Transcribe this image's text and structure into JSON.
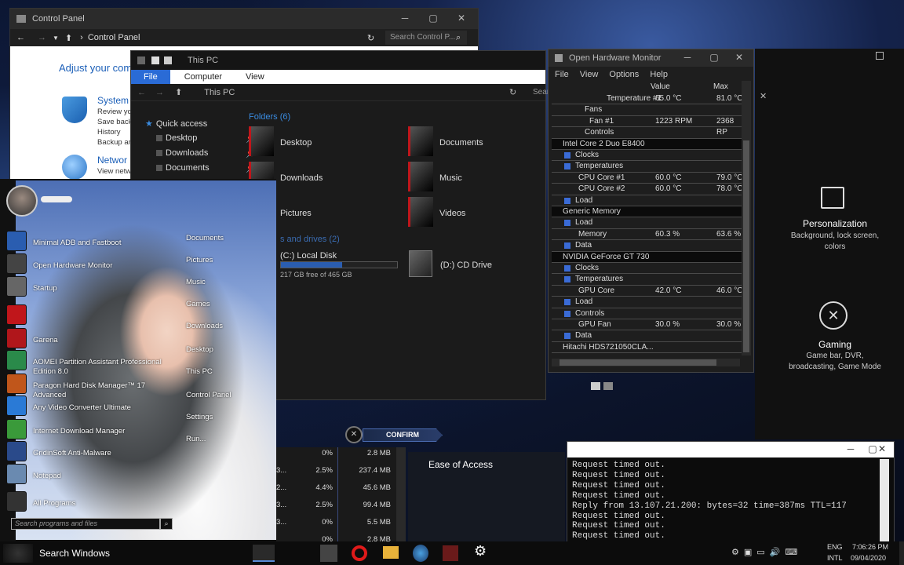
{
  "control_panel": {
    "title": "Control Panel",
    "breadcrumb": "Control Panel",
    "search_placeholder": "Search Control P...",
    "adjust": "Adjust your com",
    "system": "System",
    "system_sub": [
      "Review yo",
      "Save back",
      "History",
      "Backup ar"
    ],
    "network": "Networ",
    "network_sub": "View netw"
  },
  "explorer": {
    "title": "This PC",
    "tabs": [
      "File",
      "Computer",
      "View"
    ],
    "address": "This PC",
    "search": "Sear",
    "folders_header": "Folders (6)",
    "folders": [
      "Desktop",
      "Documents",
      "Downloads",
      "Music",
      "Pictures",
      "Videos"
    ],
    "drives_header": "s and drives (2)",
    "drive_c": "(C:) Local Disk",
    "drive_c_free": "217 GB free of 465 GB",
    "drive_c_fill": 0.53,
    "drive_d": "(D:) CD Drive",
    "quick_access": "Quick access",
    "nav": [
      "Desktop",
      "Downloads",
      "Documents"
    ]
  },
  "ohm": {
    "title": "Open Hardware Monitor",
    "menu": [
      "File",
      "View",
      "Options",
      "Help"
    ],
    "col_value": "Value",
    "col_max": "Max",
    "rows": [
      {
        "name": "Temperature #1",
        "value": "65.0 °C",
        "max": "81.0 °C",
        "indent": 70,
        "hw": false
      },
      {
        "name": "Fans",
        "value": "",
        "max": "",
        "indent": 42,
        "hw": false
      },
      {
        "name": "Fan #1",
        "value": "1223 RPM",
        "max": "2368 RP",
        "indent": 48,
        "hw": false
      },
      {
        "name": "Controls",
        "value": "",
        "max": "",
        "indent": 42,
        "hw": false
      },
      {
        "name": "Intel Core 2 Duo E8400",
        "value": "",
        "max": "",
        "indent": 14,
        "hw": true
      },
      {
        "name": "Clocks",
        "value": "",
        "max": "",
        "indent": 30,
        "hw": false
      },
      {
        "name": "Temperatures",
        "value": "",
        "max": "",
        "indent": 30,
        "hw": false
      },
      {
        "name": "CPU Core #1",
        "value": "60.0 °C",
        "max": "79.0 °C",
        "indent": 34,
        "hw": false
      },
      {
        "name": "CPU Core #2",
        "value": "60.0 °C",
        "max": "78.0 °C",
        "indent": 34,
        "hw": false
      },
      {
        "name": "Load",
        "value": "",
        "max": "",
        "indent": 30,
        "hw": false
      },
      {
        "name": "Generic Memory",
        "value": "",
        "max": "",
        "indent": 14,
        "hw": true
      },
      {
        "name": "Load",
        "value": "",
        "max": "",
        "indent": 30,
        "hw": false
      },
      {
        "name": "Memory",
        "value": "60.3 %",
        "max": "63.6 %",
        "indent": 34,
        "hw": false
      },
      {
        "name": "Data",
        "value": "",
        "max": "",
        "indent": 30,
        "hw": false
      },
      {
        "name": "NVIDIA GeForce GT 730",
        "value": "",
        "max": "",
        "indent": 14,
        "hw": true
      },
      {
        "name": "Clocks",
        "value": "",
        "max": "",
        "indent": 30,
        "hw": false
      },
      {
        "name": "Temperatures",
        "value": "",
        "max": "",
        "indent": 30,
        "hw": false
      },
      {
        "name": "GPU Core",
        "value": "42.0 °C",
        "max": "46.0 °C",
        "indent": 34,
        "hw": false
      },
      {
        "name": "Load",
        "value": "",
        "max": "",
        "indent": 30,
        "hw": false
      },
      {
        "name": "Controls",
        "value": "",
        "max": "",
        "indent": 30,
        "hw": false
      },
      {
        "name": "GPU Fan",
        "value": "30.0 %",
        "max": "30.0 %",
        "indent": 34,
        "hw": false
      },
      {
        "name": "Data",
        "value": "",
        "max": "",
        "indent": 30,
        "hw": false
      },
      {
        "name": "Hitachi HDS721050CLA...",
        "value": "",
        "max": "",
        "indent": 14,
        "hw": false
      }
    ]
  },
  "start_menu": {
    "search_placeholder": "Search programs and files",
    "programs": [
      "Minimal ADB and Fastboot",
      "Open Hardware Monitor",
      "Startup",
      "",
      "Garena",
      "AOMEI Partition Assistant Professional Edition 8.0",
      "Paragon Hard Disk Manager™ 17 Advanced",
      "Any Video Converter Ultimate",
      "Internet Download Manager",
      "GridinSoft Anti-Malware",
      "Notepad",
      "All Programs"
    ],
    "links": [
      "Documents",
      "Pictures",
      "Music",
      "Games",
      "Downloads",
      "Desktop",
      "This PC",
      "Control Panel",
      "Settings",
      "Run..."
    ]
  },
  "confirm_label": "CONFIRM",
  "settings": {
    "personalization": "Personalization",
    "personalization_sub": "Background, lock screen, colors",
    "gaming": "Gaming",
    "gaming_sub": "Game bar, DVR, broadcasting, Game Mode",
    "ease": "Ease of Access"
  },
  "taskmgr": {
    "pct": [
      "0%",
      "2.5%",
      "4.4%",
      "2.5%",
      "0%",
      "0%"
    ],
    "mem": [
      "2.8 MB",
      "237.4 MB",
      "45.6 MB",
      "99.4 MB",
      "5.5 MB",
      "2.8 MB"
    ],
    "left": [
      "3...",
      "2...",
      "3...",
      "3..."
    ]
  },
  "console": {
    "lines": [
      "Request timed out.",
      "Request timed out.",
      "Request timed out.",
      "Request timed out.",
      "Reply from 13.107.21.200: bytes=32 time=387ms TTL=117",
      "Request timed out.",
      "Request timed out.",
      "Request timed out."
    ]
  },
  "taskbar": {
    "search": "Search Windows",
    "lang1": "ENG",
    "lang2": "INTL",
    "time": "7:06:26 PM",
    "date": "09/04/2020"
  }
}
